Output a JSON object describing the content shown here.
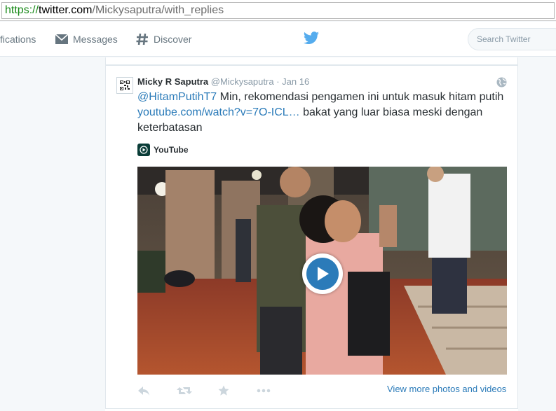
{
  "browser": {
    "url_scheme": "https://",
    "url_host": "twitter.com",
    "url_path": "/Mickysaputra/with_replies"
  },
  "nav": {
    "notifications_label": "fications",
    "messages_label": "Messages",
    "discover_label": "Discover",
    "search_placeholder": "Search Twitter"
  },
  "tweet": {
    "fullname": "Micky R Saputra",
    "username": "@Mickysaputra",
    "separator": "·",
    "date": "Jan 16",
    "mention": "@HitamPutihT7",
    "text_part1": " Min, rekomendasi pengamen ini untuk masuk hitam putih ",
    "link": "youtube.com/watch?v=7O-ICL…",
    "text_part2": "  bakat yang luar biasa meski dengan keterbatasan",
    "card_source": "YouTube",
    "view_more": "View more photos and videos"
  },
  "colors": {
    "accent": "#2b7bb9",
    "twitter_blue": "#55acee",
    "text": "#292f33",
    "muted": "#8899a6"
  },
  "icons": {
    "notifications": "bell-icon",
    "messages": "envelope-icon",
    "discover": "hashtag-icon",
    "logo": "twitter-bird-icon",
    "reply": "reply-icon",
    "retweet": "retweet-icon",
    "favorite": "star-icon",
    "more": "more-icon",
    "globe": "globe-icon",
    "play": "play-icon"
  }
}
